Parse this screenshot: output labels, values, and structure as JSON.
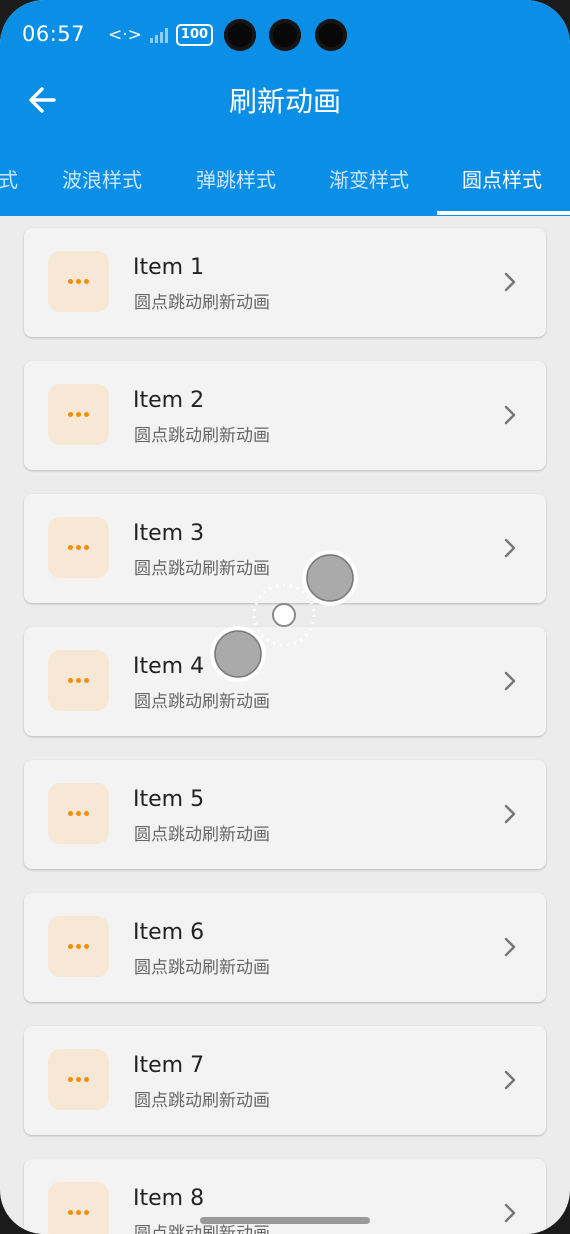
{
  "status_bar": {
    "time": "06:57",
    "network_icon": "<·>",
    "battery": "100"
  },
  "header": {
    "title": "刷新动画"
  },
  "tabs": [
    {
      "label": "式"
    },
    {
      "label": "波浪样式"
    },
    {
      "label": "弹跳样式"
    },
    {
      "label": "渐变样式"
    },
    {
      "label": "圆点样式",
      "active": true
    }
  ],
  "items": [
    {
      "title": "Item 1",
      "subtitle": "圆点跳动刷新动画"
    },
    {
      "title": "Item 2",
      "subtitle": "圆点跳动刷新动画"
    },
    {
      "title": "Item 3",
      "subtitle": "圆点跳动刷新动画"
    },
    {
      "title": "Item 4",
      "subtitle": "圆点跳动刷新动画"
    },
    {
      "title": "Item 5",
      "subtitle": "圆点跳动刷新动画"
    },
    {
      "title": "Item 6",
      "subtitle": "圆点跳动刷新动画"
    },
    {
      "title": "Item 7",
      "subtitle": "圆点跳动刷新动画"
    },
    {
      "title": "Item 8",
      "subtitle": "圆点跳动刷新动画"
    }
  ],
  "icons": {
    "back": "arrow-left-icon",
    "item": "dots-icon",
    "chevron": "chevron-right-icon"
  },
  "colors": {
    "app_bar": "#0b8fe6",
    "card": "#f3f3f3",
    "badge_bg": "#f7e8d5",
    "dots": "#fb8c00",
    "page_bg": "#ececec"
  }
}
